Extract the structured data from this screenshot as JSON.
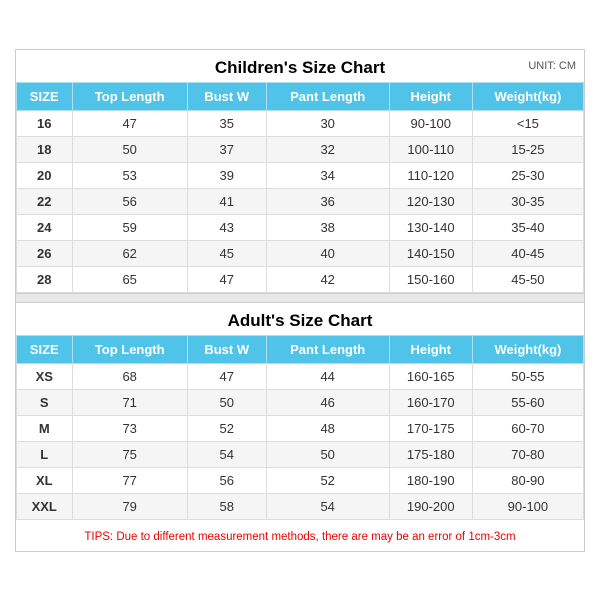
{
  "unit": "UNIT: CM",
  "children": {
    "title": "Children's Size Chart",
    "headers": [
      "SIZE",
      "Top Length",
      "Bust W",
      "Pant Length",
      "Height",
      "Weight(kg)"
    ],
    "rows": [
      [
        "16",
        "47",
        "35",
        "30",
        "90-100",
        "<15"
      ],
      [
        "18",
        "50",
        "37",
        "32",
        "100-110",
        "15-25"
      ],
      [
        "20",
        "53",
        "39",
        "34",
        "110-120",
        "25-30"
      ],
      [
        "22",
        "56",
        "41",
        "36",
        "120-130",
        "30-35"
      ],
      [
        "24",
        "59",
        "43",
        "38",
        "130-140",
        "35-40"
      ],
      [
        "26",
        "62",
        "45",
        "40",
        "140-150",
        "40-45"
      ],
      [
        "28",
        "65",
        "47",
        "42",
        "150-160",
        "45-50"
      ]
    ]
  },
  "adults": {
    "title": "Adult's Size Chart",
    "headers": [
      "SIZE",
      "Top Length",
      "Bust W",
      "Pant Length",
      "Height",
      "Weight(kg)"
    ],
    "rows": [
      [
        "XS",
        "68",
        "47",
        "44",
        "160-165",
        "50-55"
      ],
      [
        "S",
        "71",
        "50",
        "46",
        "160-170",
        "55-60"
      ],
      [
        "M",
        "73",
        "52",
        "48",
        "170-175",
        "60-70"
      ],
      [
        "L",
        "75",
        "54",
        "50",
        "175-180",
        "70-80"
      ],
      [
        "XL",
        "77",
        "56",
        "52",
        "180-190",
        "80-90"
      ],
      [
        "XXL",
        "79",
        "58",
        "54",
        "190-200",
        "90-100"
      ]
    ]
  },
  "tips": "TIPS: Due to different measurement methods, there are may be an error of 1cm-3cm"
}
